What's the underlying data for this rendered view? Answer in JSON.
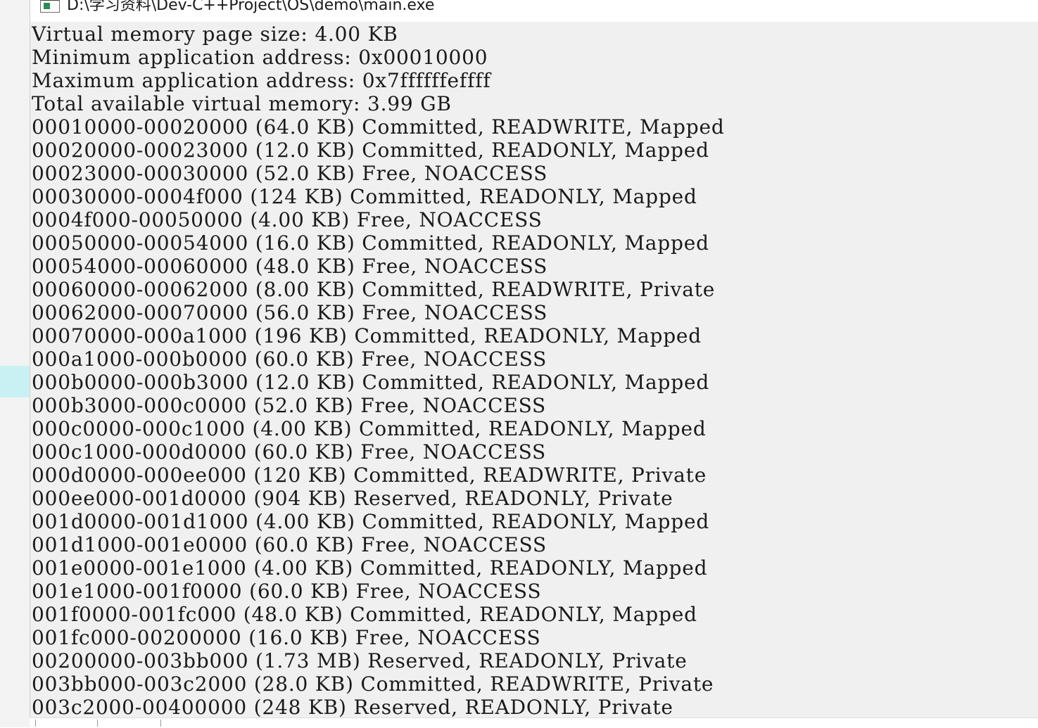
{
  "window": {
    "title": "D:\\学习资料\\Dev-C++Project\\OS\\demo\\main.exe"
  },
  "console": {
    "lines": [
      "Virtual memory page size: 4.00 KB",
      "Minimum application address: 0x00010000",
      "Maximum application address: 0x7ffffffeffff",
      "Total available virtual memory: 3.99 GB",
      "00010000-00020000 (64.0 KB) Committed, READWRITE, Mapped",
      "00020000-00023000 (12.0 KB) Committed, READONLY, Mapped",
      "00023000-00030000 (52.0 KB) Free, NOACCESS",
      "00030000-0004f000 (124 KB) Committed, READONLY, Mapped",
      "0004f000-00050000 (4.00 KB) Free, NOACCESS",
      "00050000-00054000 (16.0 KB) Committed, READONLY, Mapped",
      "00054000-00060000 (48.0 KB) Free, NOACCESS",
      "00060000-00062000 (8.00 KB) Committed, READWRITE, Private",
      "00062000-00070000 (56.0 KB) Free, NOACCESS",
      "00070000-000a1000 (196 KB) Committed, READONLY, Mapped",
      "000a1000-000b0000 (60.0 KB) Free, NOACCESS",
      "000b0000-000b3000 (12.0 KB) Committed, READONLY, Mapped",
      "000b3000-000c0000 (52.0 KB) Free, NOACCESS",
      "000c0000-000c1000 (4.00 KB) Committed, READONLY, Mapped",
      "000c1000-000d0000 (60.0 KB) Free, NOACCESS",
      "000d0000-000ee000 (120 KB) Committed, READWRITE, Private",
      "000ee000-001d0000 (904 KB) Reserved, READONLY, Private",
      "001d0000-001d1000 (4.00 KB) Committed, READONLY, Mapped",
      "001d1000-001e0000 (60.0 KB) Free, NOACCESS",
      "001e0000-001e1000 (4.00 KB) Committed, READONLY, Mapped",
      "001e1000-001f0000 (60.0 KB) Free, NOACCESS",
      "001f0000-001fc000 (48.0 KB) Committed, READONLY, Mapped",
      "001fc000-00200000 (16.0 KB) Free, NOACCESS",
      "00200000-003bb000 (1.73 MB) Reserved, READONLY, Private",
      "003bb000-003c2000 (28.0 KB) Committed, READWRITE, Private",
      "003c2000-00400000 (248 KB) Reserved, READONLY, Private"
    ]
  },
  "colors": {
    "console_background": "#f0f0f0",
    "console_text": "#1a1a1a",
    "title_bar_background": "#ffffff",
    "desktop_selection": "#c9f1f3"
  },
  "icons": {
    "app_icon": "console-app-icon"
  }
}
